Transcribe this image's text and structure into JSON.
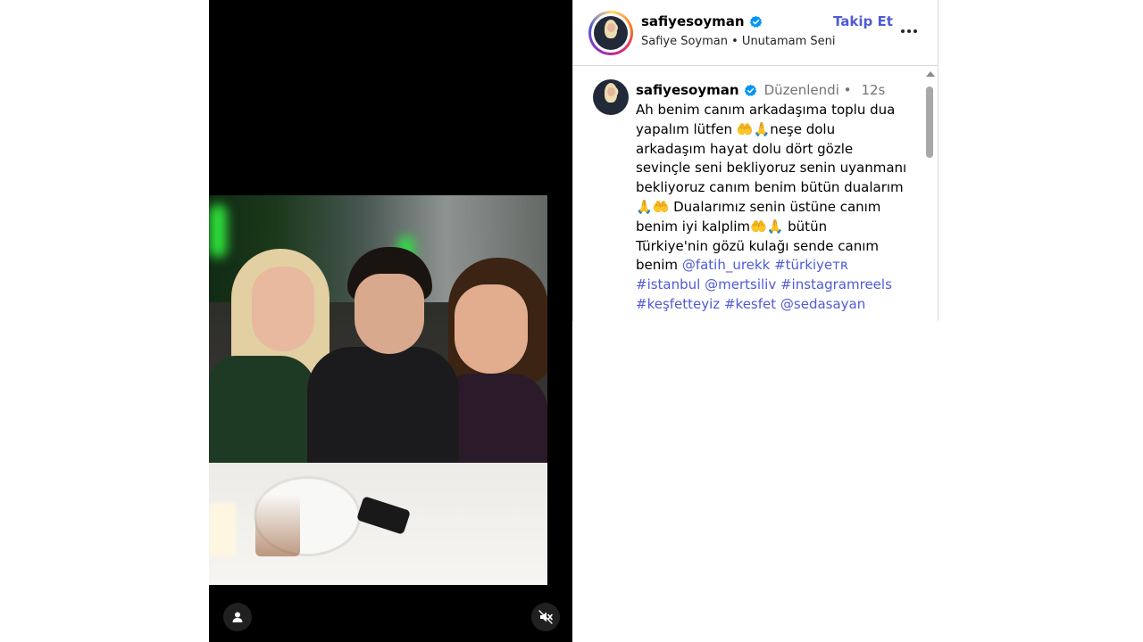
{
  "post": {
    "username": "safiyesoyman",
    "subtitle": "Safiye Soyman • Unutamam Seni",
    "follow_label": "Takip Et",
    "verified": true
  },
  "comment": {
    "username": "safiyesoyman",
    "edited": "Düzenlendi •",
    "time": "12s",
    "lines": [
      "Ah benim canım arkadaşıma toplu dua",
      "yapalım lütfen 🤲🙏neşe dolu",
      "arkadaşım hayat dolu dört gözle",
      "sevinçle seni bekliyoruz senin uyanmanı",
      "bekliyoruz canım benim bütün dualarım",
      "🙏🤲 Dualarımız senin üstüne canım",
      "benim iyi kalplim🤲🙏 bütün",
      "Türkiye'nin gözü kulağı sende canım"
    ],
    "last_line_prefix": "benim ",
    "links": {
      "mention1": "@fatih_urekk",
      "tag1": "#türkiyeᴛʀ",
      "tag2": "#istanbul",
      "mention2": "@mertsiliv",
      "tag3": "#instagramreels",
      "tag4": "#keşfetteyiz",
      "tag5": "#kesfet",
      "mention3": "@sedasayan"
    }
  },
  "icons": {
    "verified": "verified-badge-icon",
    "more": "more-options-icon",
    "tag": "user-tag-icon",
    "mute": "muted-speaker-icon"
  },
  "colors": {
    "link": "#4f5bd5",
    "verified": "#0095f6",
    "meta": "#737373"
  }
}
